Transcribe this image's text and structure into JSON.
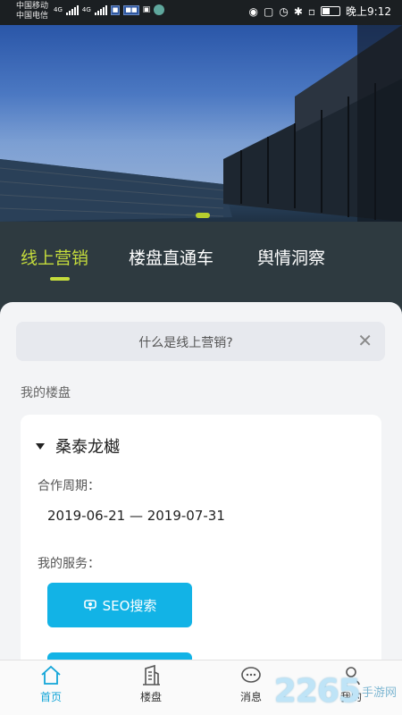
{
  "status_bar": {
    "carrier1": "中国移动",
    "carrier2": "中国电信",
    "net1": "4G",
    "net2": "4G",
    "time": "晚上9:12"
  },
  "tabs": [
    {
      "label": "线上营销"
    },
    {
      "label": "楼盘直通车"
    },
    {
      "label": "舆情洞察"
    }
  ],
  "info_bar": {
    "text": "什么是线上营销?",
    "close_icon": "close-icon"
  },
  "section_title": "我的楼盘",
  "project": {
    "name": "桑泰龙樾",
    "period_label": "合作周期：",
    "period_value": "2019-06-21 — 2019-07-31",
    "services_label": "我的服务：",
    "service_button": "SEO搜索"
  },
  "bottom_nav": [
    {
      "label": "首页",
      "icon": "home-icon"
    },
    {
      "label": "楼盘",
      "icon": "building-icon"
    },
    {
      "label": "消息",
      "icon": "message-icon"
    },
    {
      "label": "我的",
      "icon": "user-icon"
    }
  ],
  "colors": {
    "accent_green": "#c5dc3c",
    "accent_blue": "#12b3e6",
    "dark_bg": "#2e3a40"
  },
  "watermark": {
    "number": "2265",
    "text": "手游网"
  }
}
